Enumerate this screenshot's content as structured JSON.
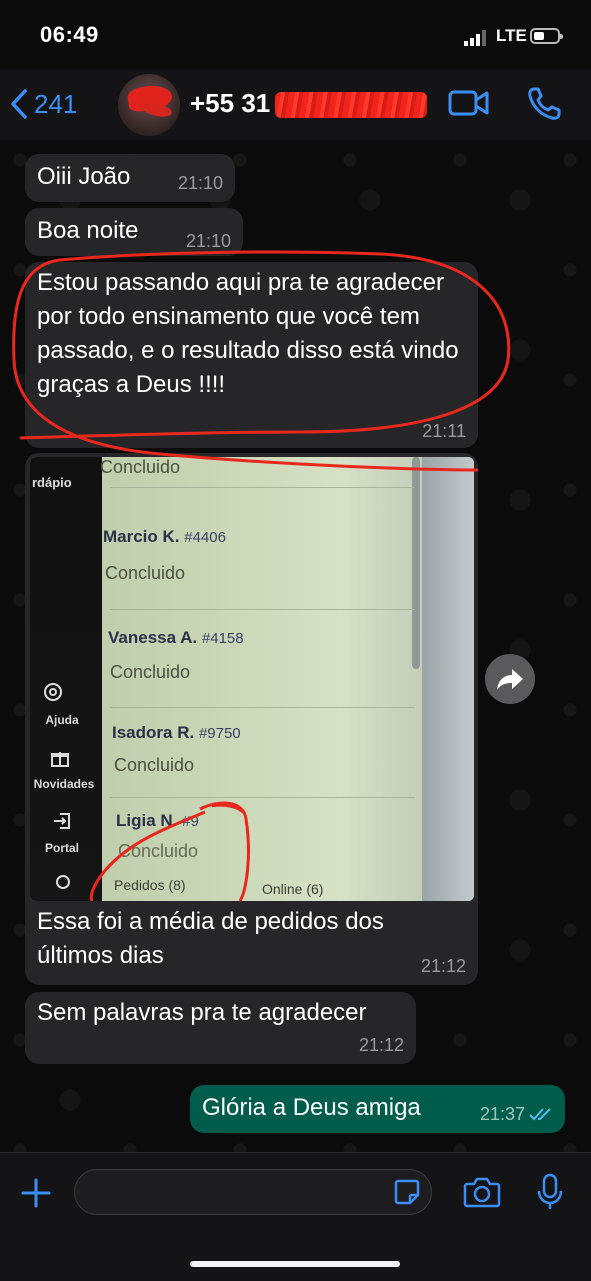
{
  "status": {
    "time": "06:49",
    "network": "LTE"
  },
  "header": {
    "back_count": "241",
    "contact_prefix": "+55 31"
  },
  "messages": [
    {
      "text": "Oiii João",
      "time": "21:10"
    },
    {
      "text": "Boa noite",
      "time": "21:10"
    },
    {
      "text": "Estou passando aqui pra te agradecer por todo ensinamento que você tem passado, e o resultado disso está vindo graças a Deus !!!!",
      "time": "21:11"
    },
    {
      "caption": "Essa foi a média de pedidos dos últimos dias",
      "time": "21:12"
    },
    {
      "text": "Sem palavras pra te agradecer",
      "time": "21:12"
    },
    {
      "text": "Glória a Deus amiga",
      "time": "21:37",
      "outgoing": true
    }
  ],
  "photo": {
    "top_status": "Concluido",
    "side_menu": [
      "rdápio",
      "Ajuda",
      "Novidades",
      "Portal"
    ],
    "orders": [
      {
        "name": "Marcio K.",
        "num": "#4406",
        "status": "Concluido"
      },
      {
        "name": "Vanessa A.",
        "num": "#4158",
        "status": "Concluido"
      },
      {
        "name": "Isadora R.",
        "num": "#9750",
        "status": "Concluido"
      },
      {
        "name": "Ligia N.",
        "num": "#9",
        "status": "Concluido"
      }
    ],
    "footer_left": "Pedidos (8)",
    "footer_right": "Online (6)"
  },
  "colors": {
    "accent": "#3b8ef3",
    "bubble_in": "#262628",
    "bubble_out": "#005c4b",
    "annotation": "#e8281e"
  },
  "icons": [
    "chevron-left-icon",
    "video-call-icon",
    "phone-icon",
    "forward-icon",
    "plus-icon",
    "sticker-icon",
    "camera-icon",
    "microphone-icon",
    "double-check-icon"
  ]
}
